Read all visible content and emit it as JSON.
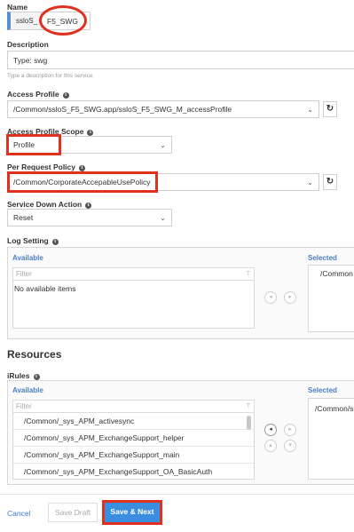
{
  "name": {
    "label": "Name",
    "prefix": "ssloS_",
    "value": "F5_SWG"
  },
  "description": {
    "label": "Description",
    "value": "Type: swg",
    "help": "Type a description for this service."
  },
  "access_profile": {
    "label": "Access Profile",
    "value": "/Common/ssloS_F5_SWG.app/ssloS_F5_SWG_M_accessProfile"
  },
  "access_profile_scope": {
    "label": "Access Profile Scope",
    "value": "Profile"
  },
  "per_request_policy": {
    "label": "Per Request Policy",
    "value": "/Common/CorporateAccepableUsePolicy"
  },
  "service_down_action": {
    "label": "Service Down Action",
    "value": "Reset"
  },
  "log_setting": {
    "label": "Log Setting",
    "available_header": "Available",
    "selected_header": "Selected",
    "filter_placeholder": "Filter",
    "empty_text": "No available items",
    "selected_items": [
      "/Common"
    ]
  },
  "resources": {
    "heading": "Resources"
  },
  "irules": {
    "label": "iRules",
    "available_header": "Available",
    "selected_header": "Selected",
    "filter_placeholder": "Filter",
    "available_items": [
      "/Common/_sys_APM_activesync",
      "/Common/_sys_APM_ExchangeSupport_helper",
      "/Common/_sys_APM_ExchangeSupport_main",
      "/Common/_sys_APM_ExchangeSupport_OA_BasicAuth"
    ],
    "selected_items": [
      "/Common/s"
    ]
  },
  "footer": {
    "cancel": "Cancel",
    "save_draft": "Save Draft",
    "save_next": "Save & Next"
  },
  "icons": {
    "info": "i",
    "refresh": "↻",
    "chevron": "⌄",
    "clear_filter": "T",
    "arrow_left": "◂",
    "arrow_right": "▸",
    "arrow_up": "▴",
    "arrow_down": "▾"
  },
  "colors": {
    "accent": "#5b8cd6",
    "highlight": "#e0301e",
    "primary_button": "#3b8de0"
  }
}
